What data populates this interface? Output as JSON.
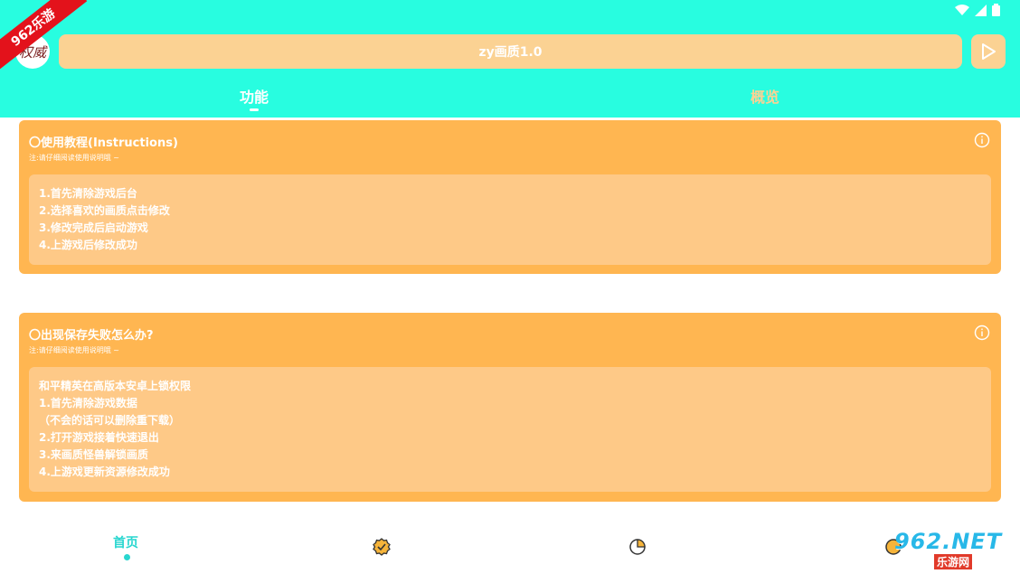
{
  "app": {
    "title": "zy画质1.0",
    "avatar_text": "权威",
    "ribbon_text": "962乐游"
  },
  "tabs": [
    {
      "label": "功能",
      "active": true
    },
    {
      "label": "概览",
      "active": false
    }
  ],
  "cards": [
    {
      "title": "〇使用教程(Instructions)",
      "note": "注:请仔细阅读使用说明哦 ~",
      "lines": [
        "1.首先清除游戏后台",
        "2.选择喜欢的画质点击修改",
        "3.修改完成后启动游戏",
        "4.上游戏后修改成功"
      ]
    },
    {
      "title": "〇出现保存失败怎么办?",
      "note": "注:请仔细阅读使用说明哦 ~",
      "lines": [
        "和平精英在高版本安卓上锁权限",
        "1.首先清除游戏数据",
        "（不会的话可以删除重下载）",
        "2.打开游戏接着快速退出",
        "3.来画质怪兽解锁画质",
        "4.上游戏更新资源修改成功"
      ]
    }
  ],
  "bottom_nav": {
    "home_label": "首页",
    "icons": [
      "badge-check-icon",
      "pie-chart-icon",
      "settings-icon"
    ]
  },
  "watermark": {
    "main": "962.NET",
    "sub": "乐游网"
  },
  "colors": {
    "accent": "#28fde0",
    "card": "#ffb651",
    "card_inner": "#fec987",
    "pill": "#fbd293",
    "nav_active": "#28d6cf"
  }
}
